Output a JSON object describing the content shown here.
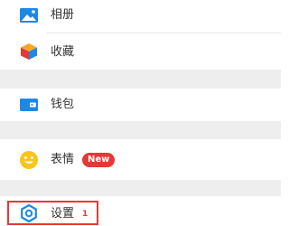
{
  "menu": {
    "items": [
      {
        "label": "相册",
        "icon": "photo-album-icon"
      },
      {
        "label": "收藏",
        "icon": "favorites-cube-icon"
      },
      {
        "label": "钱包",
        "icon": "wallet-icon"
      },
      {
        "label": "表情",
        "icon": "emoji-face-icon",
        "badge": "New"
      },
      {
        "label": "设置",
        "icon": "settings-gear-icon"
      }
    ]
  },
  "annotation": {
    "step_marker": "1"
  },
  "colors": {
    "accent_blue": "#1e88e5",
    "badge_red": "#e53935",
    "emoji_yellow": "#f9c51c",
    "section_gap": "#eeeeef"
  }
}
